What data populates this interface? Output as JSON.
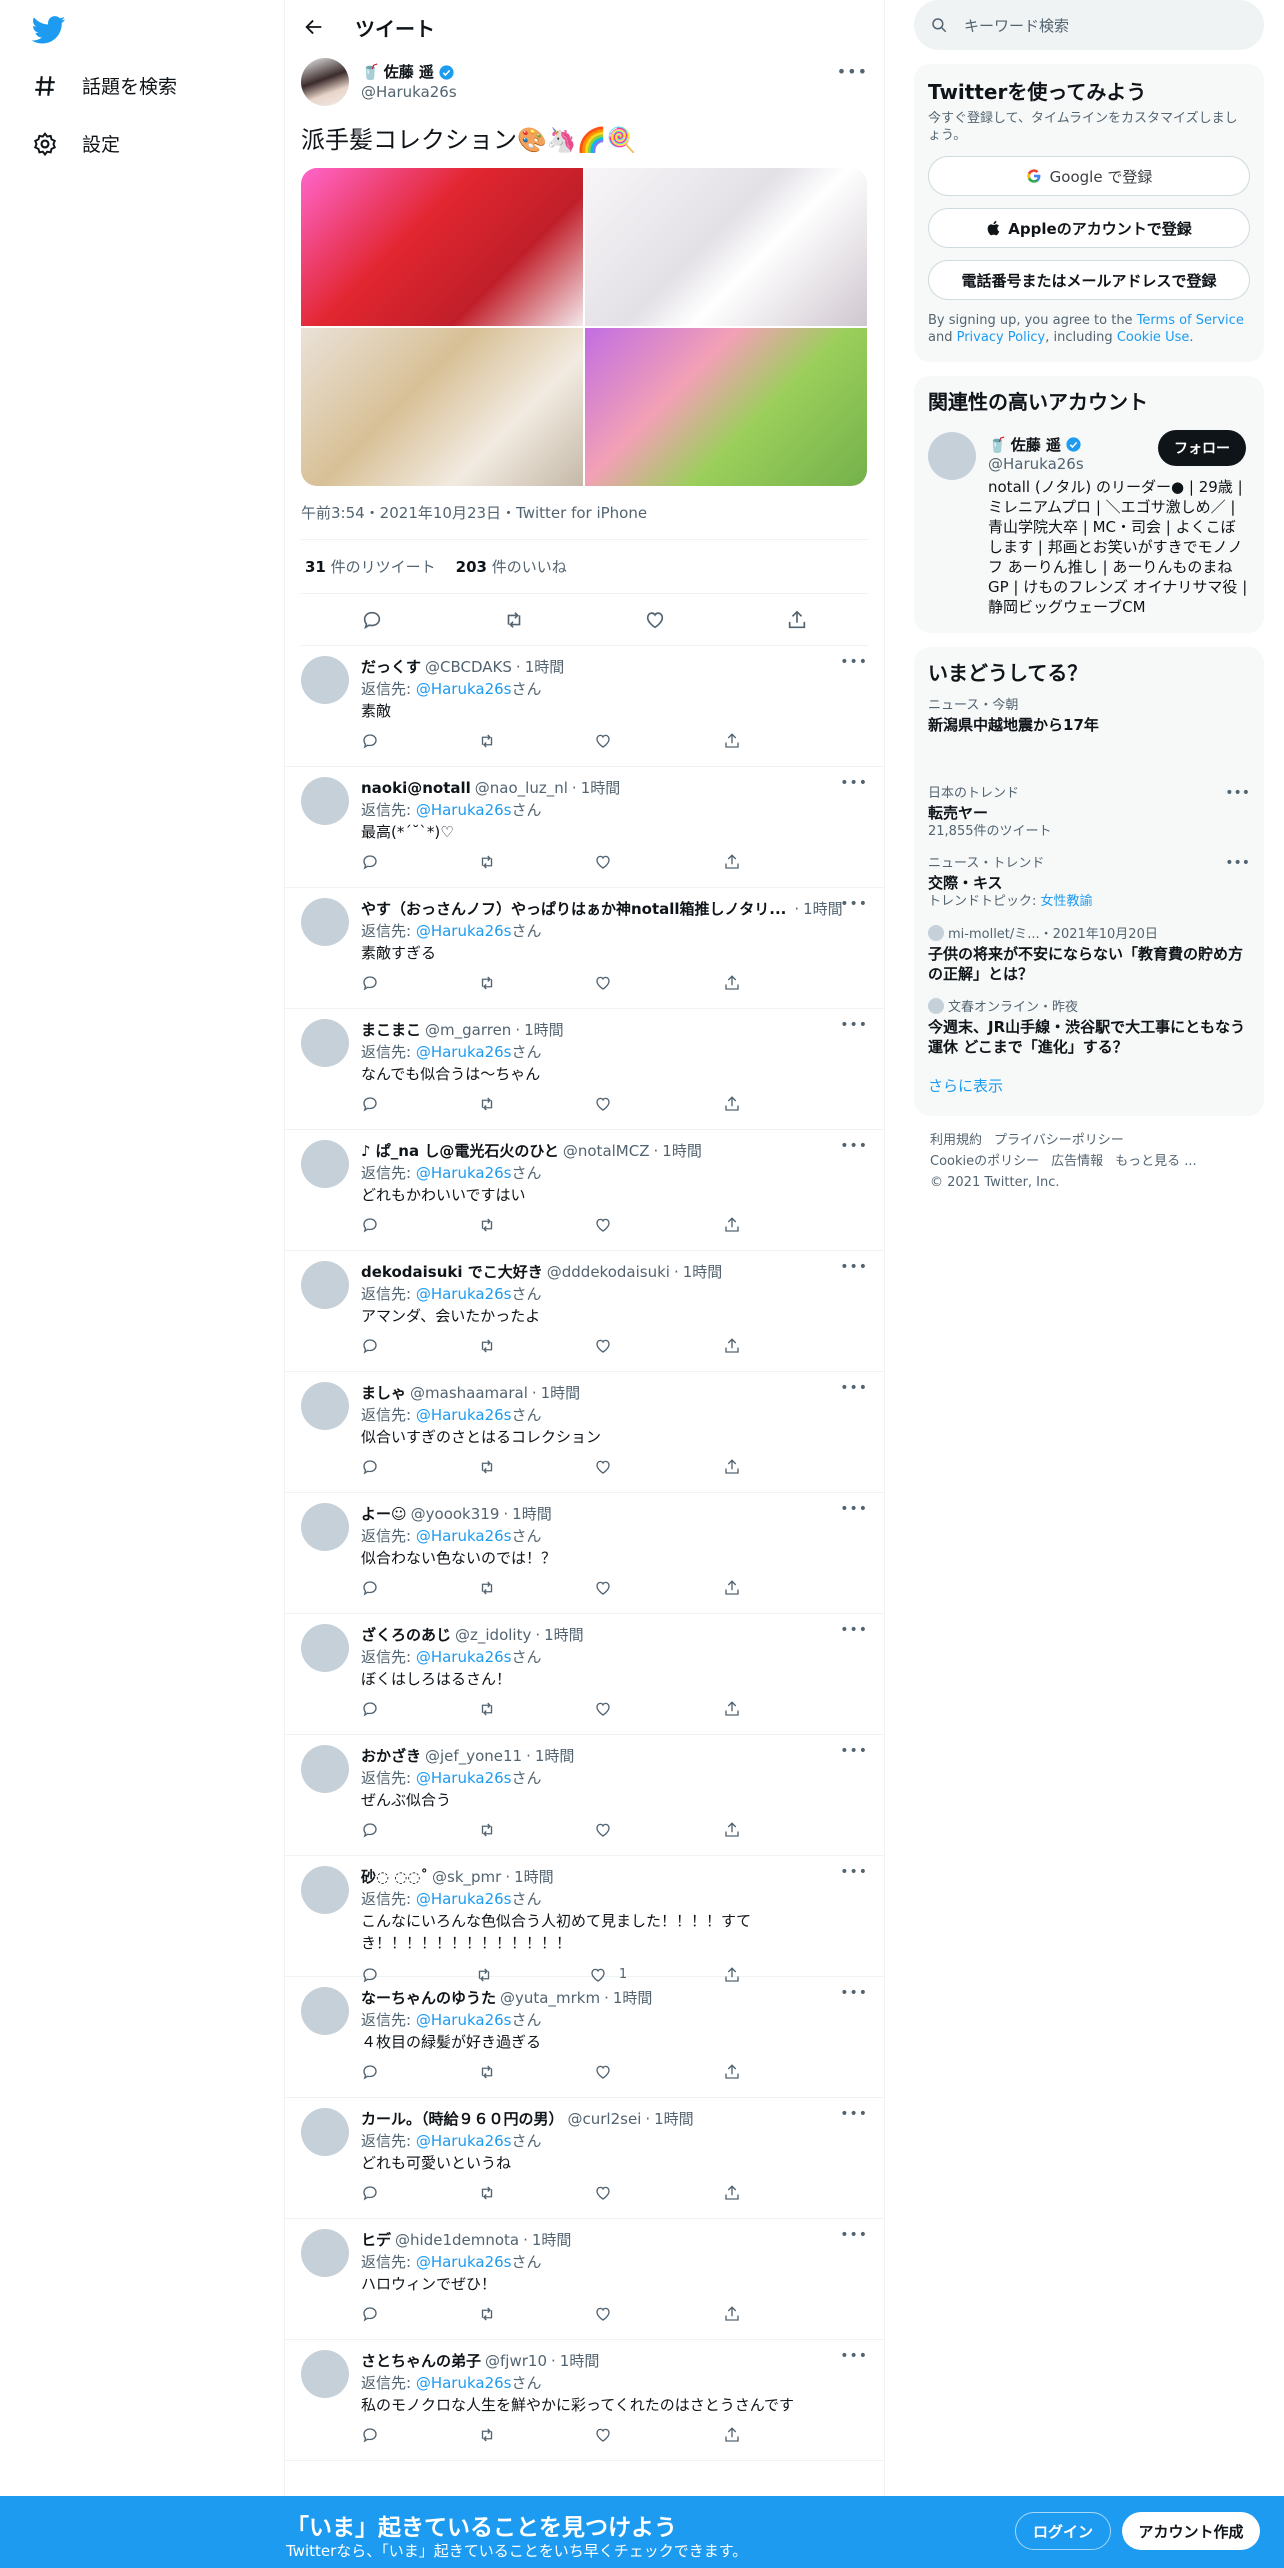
{
  "nav": {
    "explore": "話題を検索",
    "settings": "設定"
  },
  "header": {
    "title": "ツイート"
  },
  "main_tweet": {
    "name": "佐藤 遥",
    "handle": "@Haruka26s",
    "text": "派手髪コレクション🎨🦄🌈🍭",
    "meta": "午前3:54・2021年10月23日・Twitter for iPhone",
    "retweets_count": "31",
    "retweets_label": "件のリツイート",
    "likes_count": "203",
    "likes_label": "件のいいね"
  },
  "reply_prefix": "返信先: ",
  "reply_suffix": "さん",
  "replies": [
    {
      "name": "だっくす",
      "handle": "@CBCDAKS",
      "time": "1時間",
      "to": "@Haruka26s",
      "text": "素敵",
      "likes": ""
    },
    {
      "name": "naoki@notall",
      "handle": "@nao_luz_nl",
      "time": "1時間",
      "to": "@Haruka26s",
      "text": "最高(*´˘`*)♡",
      "likes": ""
    },
    {
      "name": "やす（おっさんノフ）やっぱりはぁか神notall箱推しノタリ...",
      "handle": "",
      "time": "1時間",
      "to": "@Haruka26s",
      "text": "素敵すぎる",
      "likes": ""
    },
    {
      "name": "まこまこ",
      "handle": "@m_garren",
      "time": "1時間",
      "to": "@Haruka26s",
      "text": "なんでも似合うは〜ちゃん",
      "likes": ""
    },
    {
      "name": "♪ ぱ_na し@電光石火のひと",
      "handle": "@notalMCZ",
      "time": "1時間",
      "to": "@Haruka26s",
      "text": "どれもかわいいですはい",
      "likes": ""
    },
    {
      "name": "dekodaisuki でこ大好き",
      "handle": "@dddekodaisuki",
      "time": "1時間",
      "to": "@Haruka26s",
      "text": "アマンダ、会いたかったよ",
      "likes": ""
    },
    {
      "name": "ましゃ",
      "handle": "@mashaamaral",
      "time": "1時間",
      "to": "@Haruka26s",
      "text": "似合いすぎのさとはるコレクション",
      "likes": ""
    },
    {
      "name": "よー☺",
      "handle": "@yoook319",
      "time": "1時間",
      "to": "@Haruka26s",
      "text": "似合わない色ないのでは！？",
      "likes": ""
    },
    {
      "name": "ざくろのあじ",
      "handle": "@z_idolity",
      "time": "1時間",
      "to": "@Haruka26s",
      "text": "ぼくはしろはるさん！",
      "likes": ""
    },
    {
      "name": "おかざき",
      "handle": "@jef_yone11",
      "time": "1時間",
      "to": "@Haruka26s",
      "text": "ぜんぶ似合う",
      "likes": ""
    },
    {
      "name": "砂◌ ◌◌˚",
      "handle": "@sk_pmr",
      "time": "1時間",
      "to": "@Haruka26s",
      "text": "こんなにいろんな色似合う人初めて見ました！！！！すてき！！！！！！！！！！！！！",
      "likes": "1"
    },
    {
      "name": "なーちゃんのゆうた",
      "handle": "@yuta_mrkm",
      "time": "1時間",
      "to": "@Haruka26s",
      "text": "４枚目の緑髪が好き過ぎる",
      "likes": ""
    },
    {
      "name": "カール。（時給９６０円の男）",
      "handle": "@curl2sei",
      "time": "1時間",
      "to": "@Haruka26s",
      "text": "どれも可愛いというね",
      "likes": ""
    },
    {
      "name": "ヒデ",
      "handle": "@hide1demnota",
      "time": "1時間",
      "to": "@Haruka26s",
      "text": "ハロウィンでぜひ！",
      "likes": ""
    },
    {
      "name": "さとちゃんの弟子",
      "handle": "@fjwr10",
      "time": "1時間",
      "to": "@Haruka26s",
      "text": "私のモノクロな人生を鮮やかに彩ってくれたのはさとうさんです",
      "likes": ""
    }
  ],
  "search": {
    "placeholder": "キーワード検索"
  },
  "signup_card": {
    "title": "Twitterを使ってみよう",
    "subtitle": "今すぐ登録して、タイムラインをカスタマイズしましょう。",
    "google": "Google で登録",
    "apple": "Appleのアカウントで登録",
    "phone": "電話番号またはメールアドレスで登録",
    "terms_pre": "By signing up, you agree to the ",
    "terms_tos": "Terms of Service",
    "terms_and": " and ",
    "terms_pp": "Privacy Policy",
    "terms_mid": ", including ",
    "terms_cookie": "Cookie Use",
    "terms_end": "."
  },
  "related": {
    "title": "関連性の高いアカウント",
    "name": "佐藤 遥",
    "handle": "@Haruka26s",
    "follow": "フォロー",
    "bio": "notall (ノタル) のリーダー● | 29歳 | ミレニアムプロ | ＼エゴサ激しめ／ | 青山学院大卒 | MC・司会 | よくこぼします | 邦画とお笑いがすきでモノノフ あーりん推し | あーりんものまねGP | けものフレンズ オイナリサマ役 | 静岡ビッグウェーブCM"
  },
  "trends": {
    "title": "いまどうしてる？",
    "items": [
      {
        "context": "ニュース・今朝",
        "title": "新潟県中越地震から17年",
        "count": "",
        "topic_label": "",
        "topic": ""
      },
      {
        "context": "日本のトレンド",
        "title": "転売ヤー",
        "count": "21,855件のツイート",
        "topic_label": "",
        "topic": ""
      },
      {
        "context": "ニュース・トレンド",
        "title": "交際・キス",
        "count": "",
        "topic_label": "トレンドトピック: ",
        "topic": "女性教諭"
      },
      {
        "context": "mi-mollet/ミ...・2021年10月20日",
        "title": "子供の将来が不安にならない「教育費の貯め方の正解」とは？",
        "count": "",
        "topic_label": "",
        "topic": ""
      },
      {
        "context": "文春オンライン・昨夜",
        "title": "今週末、JR山手線・渋谷駅で大工事にともなう運休 どこまで「進化」する？",
        "count": "",
        "topic_label": "",
        "topic": ""
      }
    ],
    "show_more": "さらに表示"
  },
  "footer": {
    "terms": "利用規約",
    "privacy": "プライバシーポリシー",
    "cookie": "Cookieのポリシー",
    "ads": "広告情報",
    "more": "もっと見る ...",
    "copyright": "© 2021 Twitter, Inc."
  },
  "bottom_bar": {
    "title": "「いま」起きていることを見つけよう",
    "subtitle": "Twitterなら、「いま」起きていることをいち早くチェックできます。",
    "login": "ログイン",
    "signup": "アカウント作成"
  },
  "colors": {
    "accent": "#1d9bf0",
    "text": "#0f1419",
    "secondary": "#536471"
  }
}
